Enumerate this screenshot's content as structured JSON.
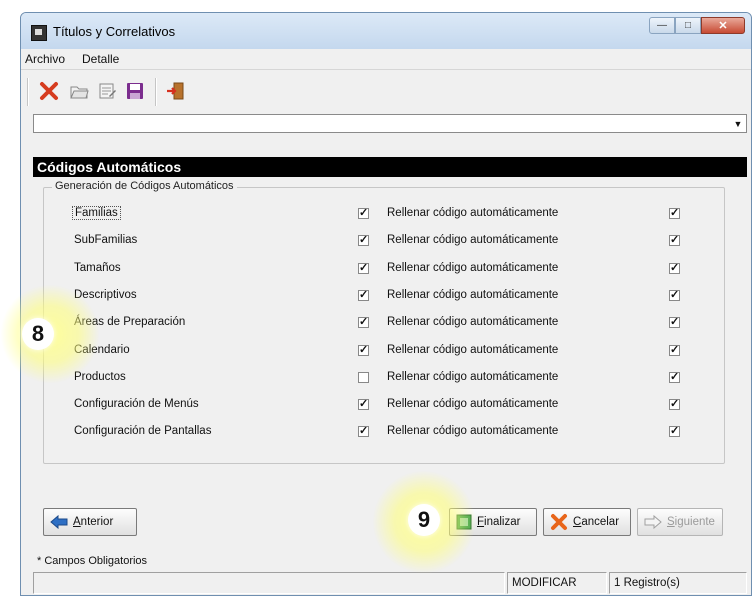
{
  "window": {
    "title": "Títulos y Correlativos"
  },
  "menu": [
    "Archivo",
    "Detalle"
  ],
  "toolbar": {
    "icons": [
      "delete-icon",
      "open-folder-icon",
      "edit-icon",
      "save-icon",
      "exit-icon"
    ]
  },
  "combo": {
    "value": ""
  },
  "section": {
    "header": "Códigos Automáticos",
    "group_label": "Generación de Códigos Automáticos",
    "rows": [
      {
        "name": "Familias",
        "checked": true,
        "fill_label": "Rellenar código automáticamente",
        "fill_checked": true
      },
      {
        "name": "SubFamilias",
        "checked": true,
        "fill_label": "Rellenar código automáticamente",
        "fill_checked": true
      },
      {
        "name": "Tamaños",
        "checked": true,
        "fill_label": "Rellenar código automáticamente",
        "fill_checked": true
      },
      {
        "name": "Descriptivos",
        "checked": true,
        "fill_label": "Rellenar código automáticamente",
        "fill_checked": true
      },
      {
        "name": "Áreas de Preparación",
        "checked": true,
        "fill_label": "Rellenar código automáticamente",
        "fill_checked": true
      },
      {
        "name": "Calendario",
        "checked": true,
        "fill_label": "Rellenar código automáticamente",
        "fill_checked": true
      },
      {
        "name": "Productos",
        "checked": false,
        "fill_label": "Rellenar código automáticamente",
        "fill_checked": true
      },
      {
        "name": "Configuración de Menús",
        "checked": true,
        "fill_label": "Rellenar código automáticamente",
        "fill_checked": true
      },
      {
        "name": "Configuración de Pantallas",
        "checked": true,
        "fill_label": "Rellenar código automáticamente",
        "fill_checked": true
      }
    ]
  },
  "buttons": {
    "anterior": {
      "first": "A",
      "rest": "nterior"
    },
    "finalizar": {
      "first": "F",
      "rest": "inalizar"
    },
    "cancelar": {
      "first": "C",
      "rest": "ancelar"
    },
    "siguiente": {
      "first": "S",
      "rest": "iguiente"
    }
  },
  "required_note": "* Campos Obligatorios",
  "status": {
    "panel1": "",
    "mode": "MODIFICAR",
    "records": "1 Registro(s)"
  },
  "markers": {
    "m8": "8",
    "m9": "9"
  },
  "colors": {
    "header_bg": "#000000",
    "delete_red": "#d63c1f",
    "save_purple": "#7b2d8e",
    "highlight": "#ffff96"
  }
}
